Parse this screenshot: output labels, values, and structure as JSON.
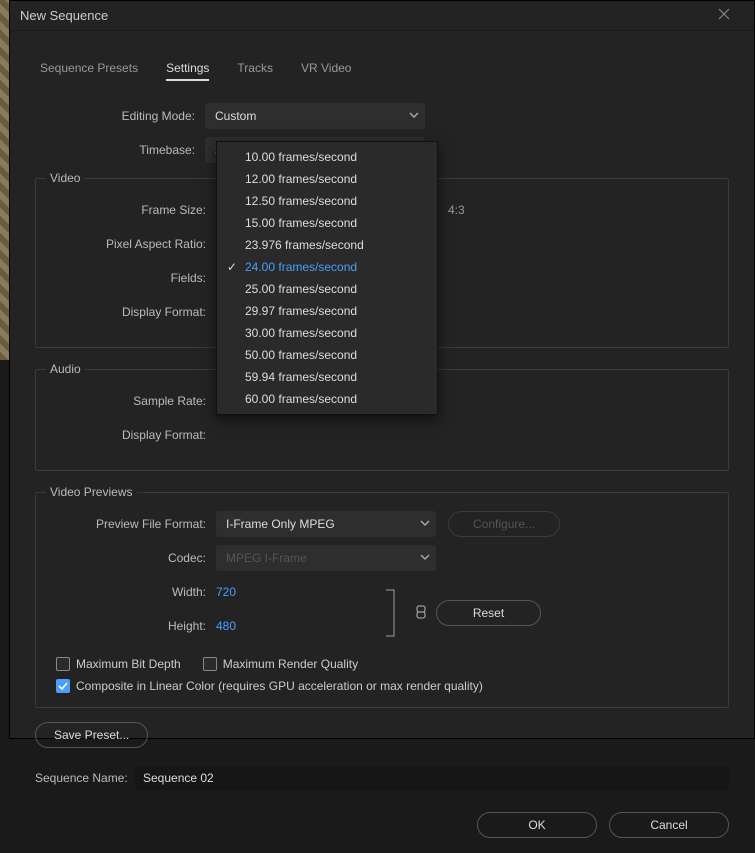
{
  "window": {
    "title": "New Sequence"
  },
  "tabs": {
    "presets": "Sequence Presets",
    "settings": "Settings",
    "tracks": "Tracks",
    "vr": "VR Video"
  },
  "labels": {
    "editing_mode": "Editing Mode:",
    "timebase": "Timebase:",
    "frame_size": "Frame Size:",
    "pixel_aspect": "Pixel Aspect Ratio:",
    "fields": "Fields:",
    "display_format_v": "Display Format:",
    "sample_rate": "Sample Rate:",
    "display_format_a": "Display Format:",
    "preview_format": "Preview File Format:",
    "codec": "Codec:",
    "width": "Width:",
    "height": "Height:",
    "sequence_name": "Sequence Name:"
  },
  "groups": {
    "video": "Video",
    "audio": "Audio",
    "previews": "Video Previews"
  },
  "values": {
    "editing_mode": "Custom",
    "timebase": "24.00  frames/second",
    "aspect_text": "4:3",
    "preview_format": "I-Frame Only MPEG",
    "codec": "MPEG I-Frame",
    "width": "720",
    "height": "480",
    "sequence_name": "Sequence 02"
  },
  "timebase_options": [
    "10.00  frames/second",
    "12.00  frames/second",
    "12.50  frames/second",
    "15.00  frames/second",
    "23.976  frames/second",
    "24.00  frames/second",
    "25.00  frames/second",
    "29.97  frames/second",
    "30.00  frames/second",
    "50.00  frames/second",
    "59.94  frames/second",
    "60.00  frames/second"
  ],
  "timebase_selected_index": 5,
  "buttons": {
    "configure": "Configure...",
    "reset": "Reset",
    "save_preset": "Save Preset...",
    "ok": "OK",
    "cancel": "Cancel"
  },
  "checkboxes": {
    "max_bit_depth": {
      "label": "Maximum Bit Depth",
      "checked": false
    },
    "max_render_quality": {
      "label": "Maximum Render Quality",
      "checked": false
    },
    "composite_linear": {
      "label": "Composite in Linear Color (requires GPU acceleration or max render quality)",
      "checked": true
    }
  }
}
